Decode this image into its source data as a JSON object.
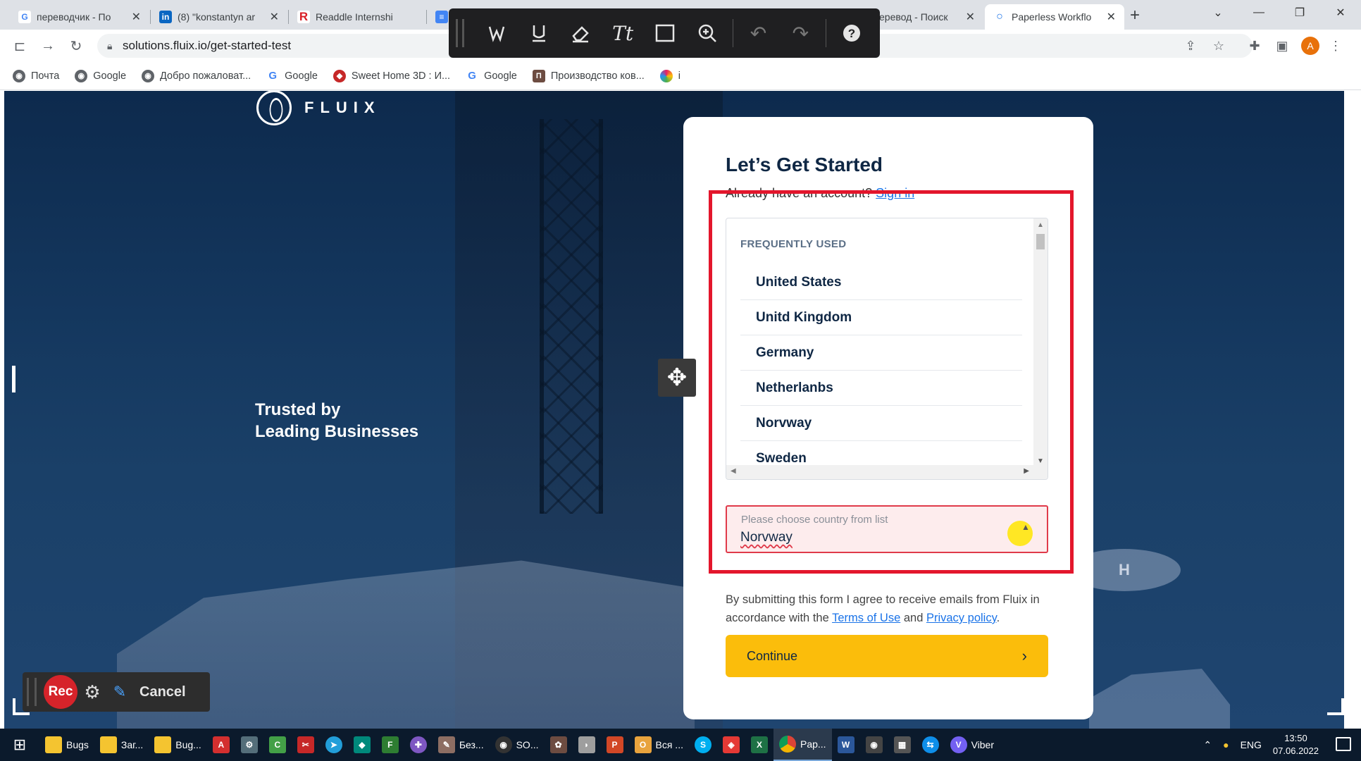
{
  "browser": {
    "tabs": [
      {
        "title": "переводчик - По",
        "icon": "google-icon",
        "color": "#4285f4",
        "letter": "G"
      },
      {
        "title": "(8) \"konstantyn ar",
        "icon": "linkedin-icon",
        "color": "#0a66c2",
        "letter": "in"
      },
      {
        "title": "Readdle Internshi",
        "icon": "readdle-icon",
        "color": "#d91f26",
        "letter": "R"
      },
      {
        "title": "еревод - Поиск",
        "icon": "yandex-icon",
        "color": "#fc3f1d",
        "letter": "Я"
      },
      {
        "title": "Paperless Workflo",
        "icon": "fluix-icon",
        "color": "#1a73e8",
        "letter": "○",
        "active": true
      }
    ],
    "url": "solutions.fluix.io/get-started-test",
    "profile_initial": "A",
    "bookmarks": [
      {
        "label": "Почта",
        "icon": "globe-icon",
        "color": "#5f6368",
        "letter": "◉"
      },
      {
        "label": "Google",
        "icon": "globe-icon",
        "color": "#5f6368",
        "letter": "◉"
      },
      {
        "label": "Добро пожаловат...",
        "icon": "globe-icon",
        "color": "#5f6368",
        "letter": "◉"
      },
      {
        "label": "Google",
        "icon": "google-icon",
        "color": "#4285f4",
        "letter": "G"
      },
      {
        "label": "Sweet Home 3D : И...",
        "icon": "sweethome-icon",
        "color": "#c62828",
        "letter": "◆"
      },
      {
        "label": "Google",
        "icon": "google-icon",
        "color": "#4285f4",
        "letter": "G"
      },
      {
        "label": "Производство ков...",
        "icon": "carpet-icon",
        "color": "#6d4c41",
        "letter": "П"
      },
      {
        "label": "i",
        "icon": "colorwheel-icon",
        "color": "#e91e63",
        "letter": "○"
      }
    ]
  },
  "page": {
    "logo_text": "FLUIX",
    "tagline_line1": "Trusted by",
    "tagline_line2": "Leading Businesses",
    "helipad_letter": "H"
  },
  "form": {
    "title": "Let’s Get Started",
    "subtitle_prefix": "Already have an account?",
    "signin_link": "Sign in",
    "dropdown_header": "FREQUENTLY USED",
    "countries": [
      "United States",
      "Unitd Kingdom",
      "Germany",
      "Netherlanbs",
      "Norvway",
      "Sweden"
    ],
    "country_label": "Please choose country from list",
    "country_value": "Norvway",
    "consent_text": "By submitting this form I agree to receive emails from Fluix in accordance with the",
    "terms_link": "Terms of Use",
    "and_text": "and",
    "privacy_link": "Privacy policy",
    "continue_label": "Continue",
    "highlight_color": "#e3162c",
    "button_color": "#fbbd0b"
  },
  "recorder": {
    "rec_label": "Rec",
    "cancel_label": "Cancel"
  },
  "taskbar": {
    "apps": [
      {
        "label": "Bugs",
        "icon": "folder-icon",
        "color": "#f4c430",
        "letter": "▮"
      },
      {
        "label": "Заг...",
        "icon": "folder-icon",
        "color": "#f4c430",
        "letter": "▮"
      },
      {
        "label": "Bug...",
        "icon": "folder-icon",
        "color": "#f4c430",
        "letter": "▮"
      },
      {
        "label": "",
        "icon": "acrobat-icon",
        "color": "#d32f2f",
        "letter": "A"
      },
      {
        "label": "",
        "icon": "settings-icon",
        "color": "#546e7a",
        "letter": "⚙"
      },
      {
        "label": "",
        "icon": "cleanup-icon",
        "color": "#43a047",
        "letter": "C"
      },
      {
        "label": "",
        "icon": "snip-icon",
        "color": "#c62828",
        "letter": "✂"
      },
      {
        "label": "",
        "icon": "telegram-icon",
        "color": "#229ed9",
        "letter": "➤"
      },
      {
        "label": "",
        "icon": "app-icon",
        "color": "#00897b",
        "letter": "◆"
      },
      {
        "label": "",
        "icon": "app-icon",
        "color": "#2e7d32",
        "letter": "F"
      },
      {
        "label": "",
        "icon": "app-icon",
        "color": "#7e57c2",
        "letter": "✚"
      },
      {
        "label": "Без...",
        "icon": "paint-icon",
        "color": "#8d6e63",
        "letter": "✎"
      },
      {
        "label": "SO...",
        "icon": "obs-icon",
        "color": "#333333",
        "letter": "◉"
      },
      {
        "label": "",
        "icon": "app-icon",
        "color": "#6d4c41",
        "letter": "✿"
      },
      {
        "label": "",
        "icon": "app-icon",
        "color": "#9e9e9e",
        "letter": "◗"
      },
      {
        "label": "",
        "icon": "powerpoint-icon",
        "color": "#d24726",
        "letter": "P"
      },
      {
        "label": "Вся ...",
        "icon": "outlook-icon",
        "color": "#e8a33d",
        "letter": "O"
      },
      {
        "label": "",
        "icon": "skype-icon",
        "color": "#00aff0",
        "letter": "S"
      },
      {
        "label": "",
        "icon": "app-icon",
        "color": "#e53935",
        "letter": "◈"
      },
      {
        "label": "",
        "icon": "excel-icon",
        "color": "#1e7145",
        "letter": "X"
      },
      {
        "label": "Pap...",
        "icon": "chrome-icon",
        "color": "#4285f4",
        "letter": "◉",
        "active": true
      },
      {
        "label": "",
        "icon": "word-icon",
        "color": "#2b579a",
        "letter": "W"
      },
      {
        "label": "",
        "icon": "camera-icon",
        "color": "#444444",
        "letter": "◉"
      },
      {
        "label": "",
        "icon": "calculator-icon",
        "color": "#555555",
        "letter": "▦"
      },
      {
        "label": "",
        "icon": "teamviewer-icon",
        "color": "#0e8ee9",
        "letter": "⇆"
      },
      {
        "label": "Viber",
        "icon": "viber-icon",
        "color": "#7360f2",
        "letter": "V"
      }
    ],
    "language": "ENG",
    "time": "13:50",
    "date": "07.06.2022"
  }
}
